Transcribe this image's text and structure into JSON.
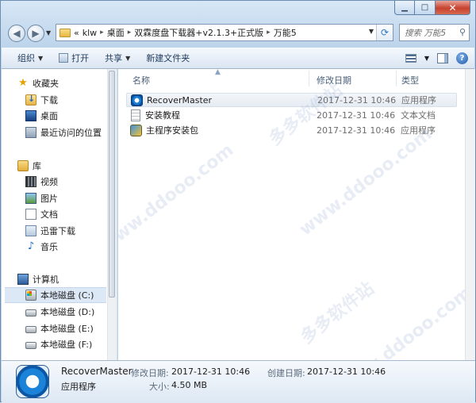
{
  "window": {
    "controls": {
      "minimize": "▁",
      "maximize": "□",
      "close": "✕"
    }
  },
  "address": {
    "overflow": "«",
    "crumbs": [
      "klw",
      "桌面",
      "双霖度盘下载器+v2.1.3+正式版",
      "万能5"
    ],
    "search_placeholder": "搜索 万能5"
  },
  "toolbar": {
    "organize": "组织",
    "open": "打开",
    "share": "共享",
    "new_folder": "新建文件夹"
  },
  "sidebar": {
    "favorites_header": "收藏夹",
    "favorites": [
      {
        "label": "下载",
        "icon": "downloads-icon"
      },
      {
        "label": "桌面",
        "icon": "desktop-icon"
      },
      {
        "label": "最近访问的位置",
        "icon": "recent-places-icon"
      }
    ],
    "libraries_header": "库",
    "libraries": [
      {
        "label": "视频",
        "icon": "video-icon"
      },
      {
        "label": "图片",
        "icon": "pictures-icon"
      },
      {
        "label": "文档",
        "icon": "documents-icon"
      },
      {
        "label": "迅雷下载",
        "icon": "xunlei-icon"
      },
      {
        "label": "音乐",
        "icon": "music-icon"
      }
    ],
    "computer_header": "计算机",
    "drives": [
      {
        "label": "本地磁盘 (C:)",
        "selected": true
      },
      {
        "label": "本地磁盘 (D:)"
      },
      {
        "label": "本地磁盘 (E:)"
      },
      {
        "label": "本地磁盘 (F:)"
      }
    ]
  },
  "file_list": {
    "columns": {
      "name": "名称",
      "date": "修改日期",
      "type": "类型"
    },
    "rows": [
      {
        "name": "RecoverMaster",
        "date": "2017-12-31 10:46",
        "type": "应用程序",
        "icon": "app-icon"
      },
      {
        "name": "安装教程",
        "date": "2017-12-31 10:46",
        "type": "文本文档",
        "icon": "text-file-icon"
      },
      {
        "name": "主程序安装包",
        "date": "2017-12-31 10:46",
        "type": "应用程序",
        "icon": "installer-icon"
      }
    ]
  },
  "details": {
    "filename": "RecoverMaster",
    "filetype": "应用程序",
    "modified_label": "修改日期:",
    "modified_value": "2017-12-31 10:46",
    "created_label": "创建日期:",
    "created_value": "2017-12-31 10:46",
    "size_label": "大小:",
    "size_value": "4.50 MB"
  },
  "watermark": {
    "text_cn": "多多软件站",
    "text_url": "www.ddooo.com"
  }
}
